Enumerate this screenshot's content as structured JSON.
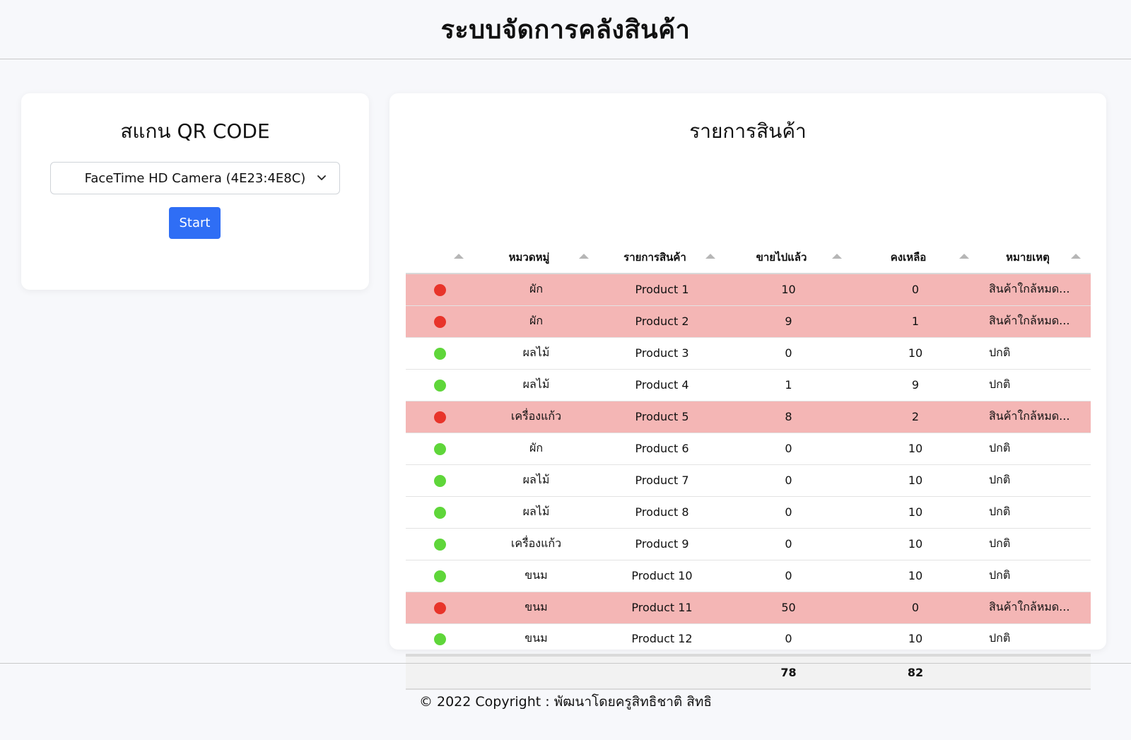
{
  "header": {
    "title": "ระบบจัดการคลังสินค้า"
  },
  "scan": {
    "title": "สแกน QR CODE",
    "camera_selected": "FaceTime HD Camera (4E23:4E8C)",
    "start_label": "Start"
  },
  "inventory": {
    "title": "รายการสินค้า",
    "columns": [
      "",
      "หมวดหมู่",
      "รายการสินค้า",
      "ขายไปแล้ว",
      "คงเหลือ",
      "หมายเหตุ"
    ],
    "status_colors": {
      "warn": "#e8342a",
      "ok": "#5fd63a"
    },
    "rows": [
      {
        "status": "warn",
        "category": "ผัก",
        "product": "Product 1",
        "sold": "10",
        "remaining": "0",
        "note": "สินค้าใกล้หมด..."
      },
      {
        "status": "warn",
        "category": "ผัก",
        "product": "Product 2",
        "sold": "9",
        "remaining": "1",
        "note": "สินค้าใกล้หมด..."
      },
      {
        "status": "ok",
        "category": "ผลไม้",
        "product": "Product 3",
        "sold": "0",
        "remaining": "10",
        "note": "ปกติ"
      },
      {
        "status": "ok",
        "category": "ผลไม้",
        "product": "Product 4",
        "sold": "1",
        "remaining": "9",
        "note": "ปกติ"
      },
      {
        "status": "warn",
        "category": "เครื่องแก้ว",
        "product": "Product 5",
        "sold": "8",
        "remaining": "2",
        "note": "สินค้าใกล้หมด..."
      },
      {
        "status": "ok",
        "category": "ผัก",
        "product": "Product 6",
        "sold": "0",
        "remaining": "10",
        "note": "ปกติ"
      },
      {
        "status": "ok",
        "category": "ผลไม้",
        "product": "Product 7",
        "sold": "0",
        "remaining": "10",
        "note": "ปกติ"
      },
      {
        "status": "ok",
        "category": "ผลไม้",
        "product": "Product 8",
        "sold": "0",
        "remaining": "10",
        "note": "ปกติ"
      },
      {
        "status": "ok",
        "category": "เครื่องแก้ว",
        "product": "Product 9",
        "sold": "0",
        "remaining": "10",
        "note": "ปกติ"
      },
      {
        "status": "ok",
        "category": "ขนม",
        "product": "Product 10",
        "sold": "0",
        "remaining": "10",
        "note": "ปกติ"
      },
      {
        "status": "warn",
        "category": "ขนม",
        "product": "Product 11",
        "sold": "50",
        "remaining": "0",
        "note": "สินค้าใกล้หมด..."
      },
      {
        "status": "ok",
        "category": "ขนม",
        "product": "Product 12",
        "sold": "0",
        "remaining": "10",
        "note": "ปกติ"
      }
    ],
    "totals": {
      "sold": "78",
      "remaining": "82"
    }
  },
  "footer": {
    "copyright": "© 2022 Copyright : พัฒนาโดยครูสิทธิชาติ สิทธิ"
  }
}
